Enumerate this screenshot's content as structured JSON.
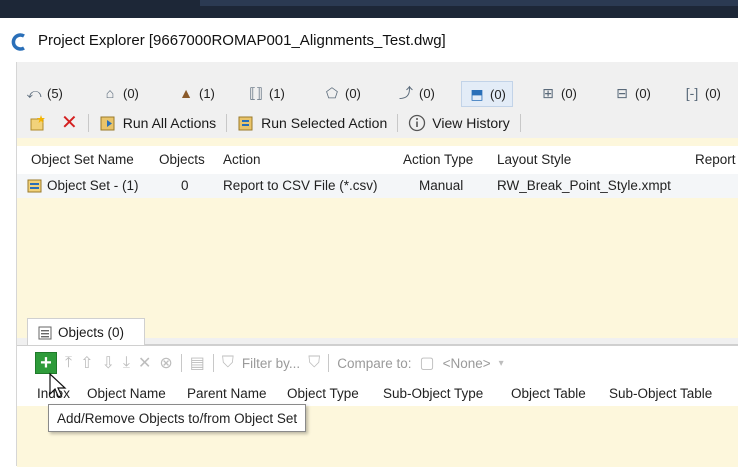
{
  "window": {
    "title": "Project Explorer [9667000ROMAP001_Alignments_Test.dwg]"
  },
  "tabs": [
    {
      "icon": "alignment-icon",
      "count": "(5)"
    },
    {
      "icon": "parcel-icon",
      "count": "(0)"
    },
    {
      "icon": "corridor-icon",
      "count": "(1)"
    },
    {
      "icon": "assembly-icon",
      "count": "(1)"
    },
    {
      "icon": "surface-icon",
      "count": "(0)"
    },
    {
      "icon": "feature-line-icon",
      "count": "(0)"
    },
    {
      "icon": "profile-view-icon",
      "count": "(0)"
    },
    {
      "icon": "section-icon",
      "count": "(0)"
    },
    {
      "icon": "section-view-icon",
      "count": "(0)"
    },
    {
      "icon": "sample-line-icon",
      "count": "(0)"
    }
  ],
  "toolbar": {
    "run_all_label": "Run All Actions",
    "run_selected_label": "Run Selected Action",
    "view_history_label": "View History"
  },
  "grid": {
    "columns": [
      "Object Set Name",
      "Objects",
      "Action",
      "Action Type",
      "Layout Style",
      "Report"
    ],
    "rows": [
      {
        "name": "Object Set - (1)",
        "objects": "0",
        "action": "Report to CSV File (*.csv)",
        "action_type": "Manual",
        "layout_style": "RW_Break_Point_Style.xmpt"
      }
    ]
  },
  "objects_tab": {
    "label": "Objects (0)"
  },
  "objects_toolbar": {
    "filter_label": "Filter by...",
    "compare_label": "Compare to:",
    "compare_value": "<None>"
  },
  "objects_grid": {
    "columns": [
      "Index",
      "Object Name",
      "Parent Name",
      "Object Type",
      "Sub-Object Type",
      "Object Table",
      "Sub-Object Table"
    ]
  },
  "tooltip": {
    "text": "Add/Remove Objects to/from Object Set"
  },
  "colors": {
    "grid_body": "#fdf7dc",
    "add_button": "#2e9b3a",
    "delete_red": "#d42020"
  }
}
